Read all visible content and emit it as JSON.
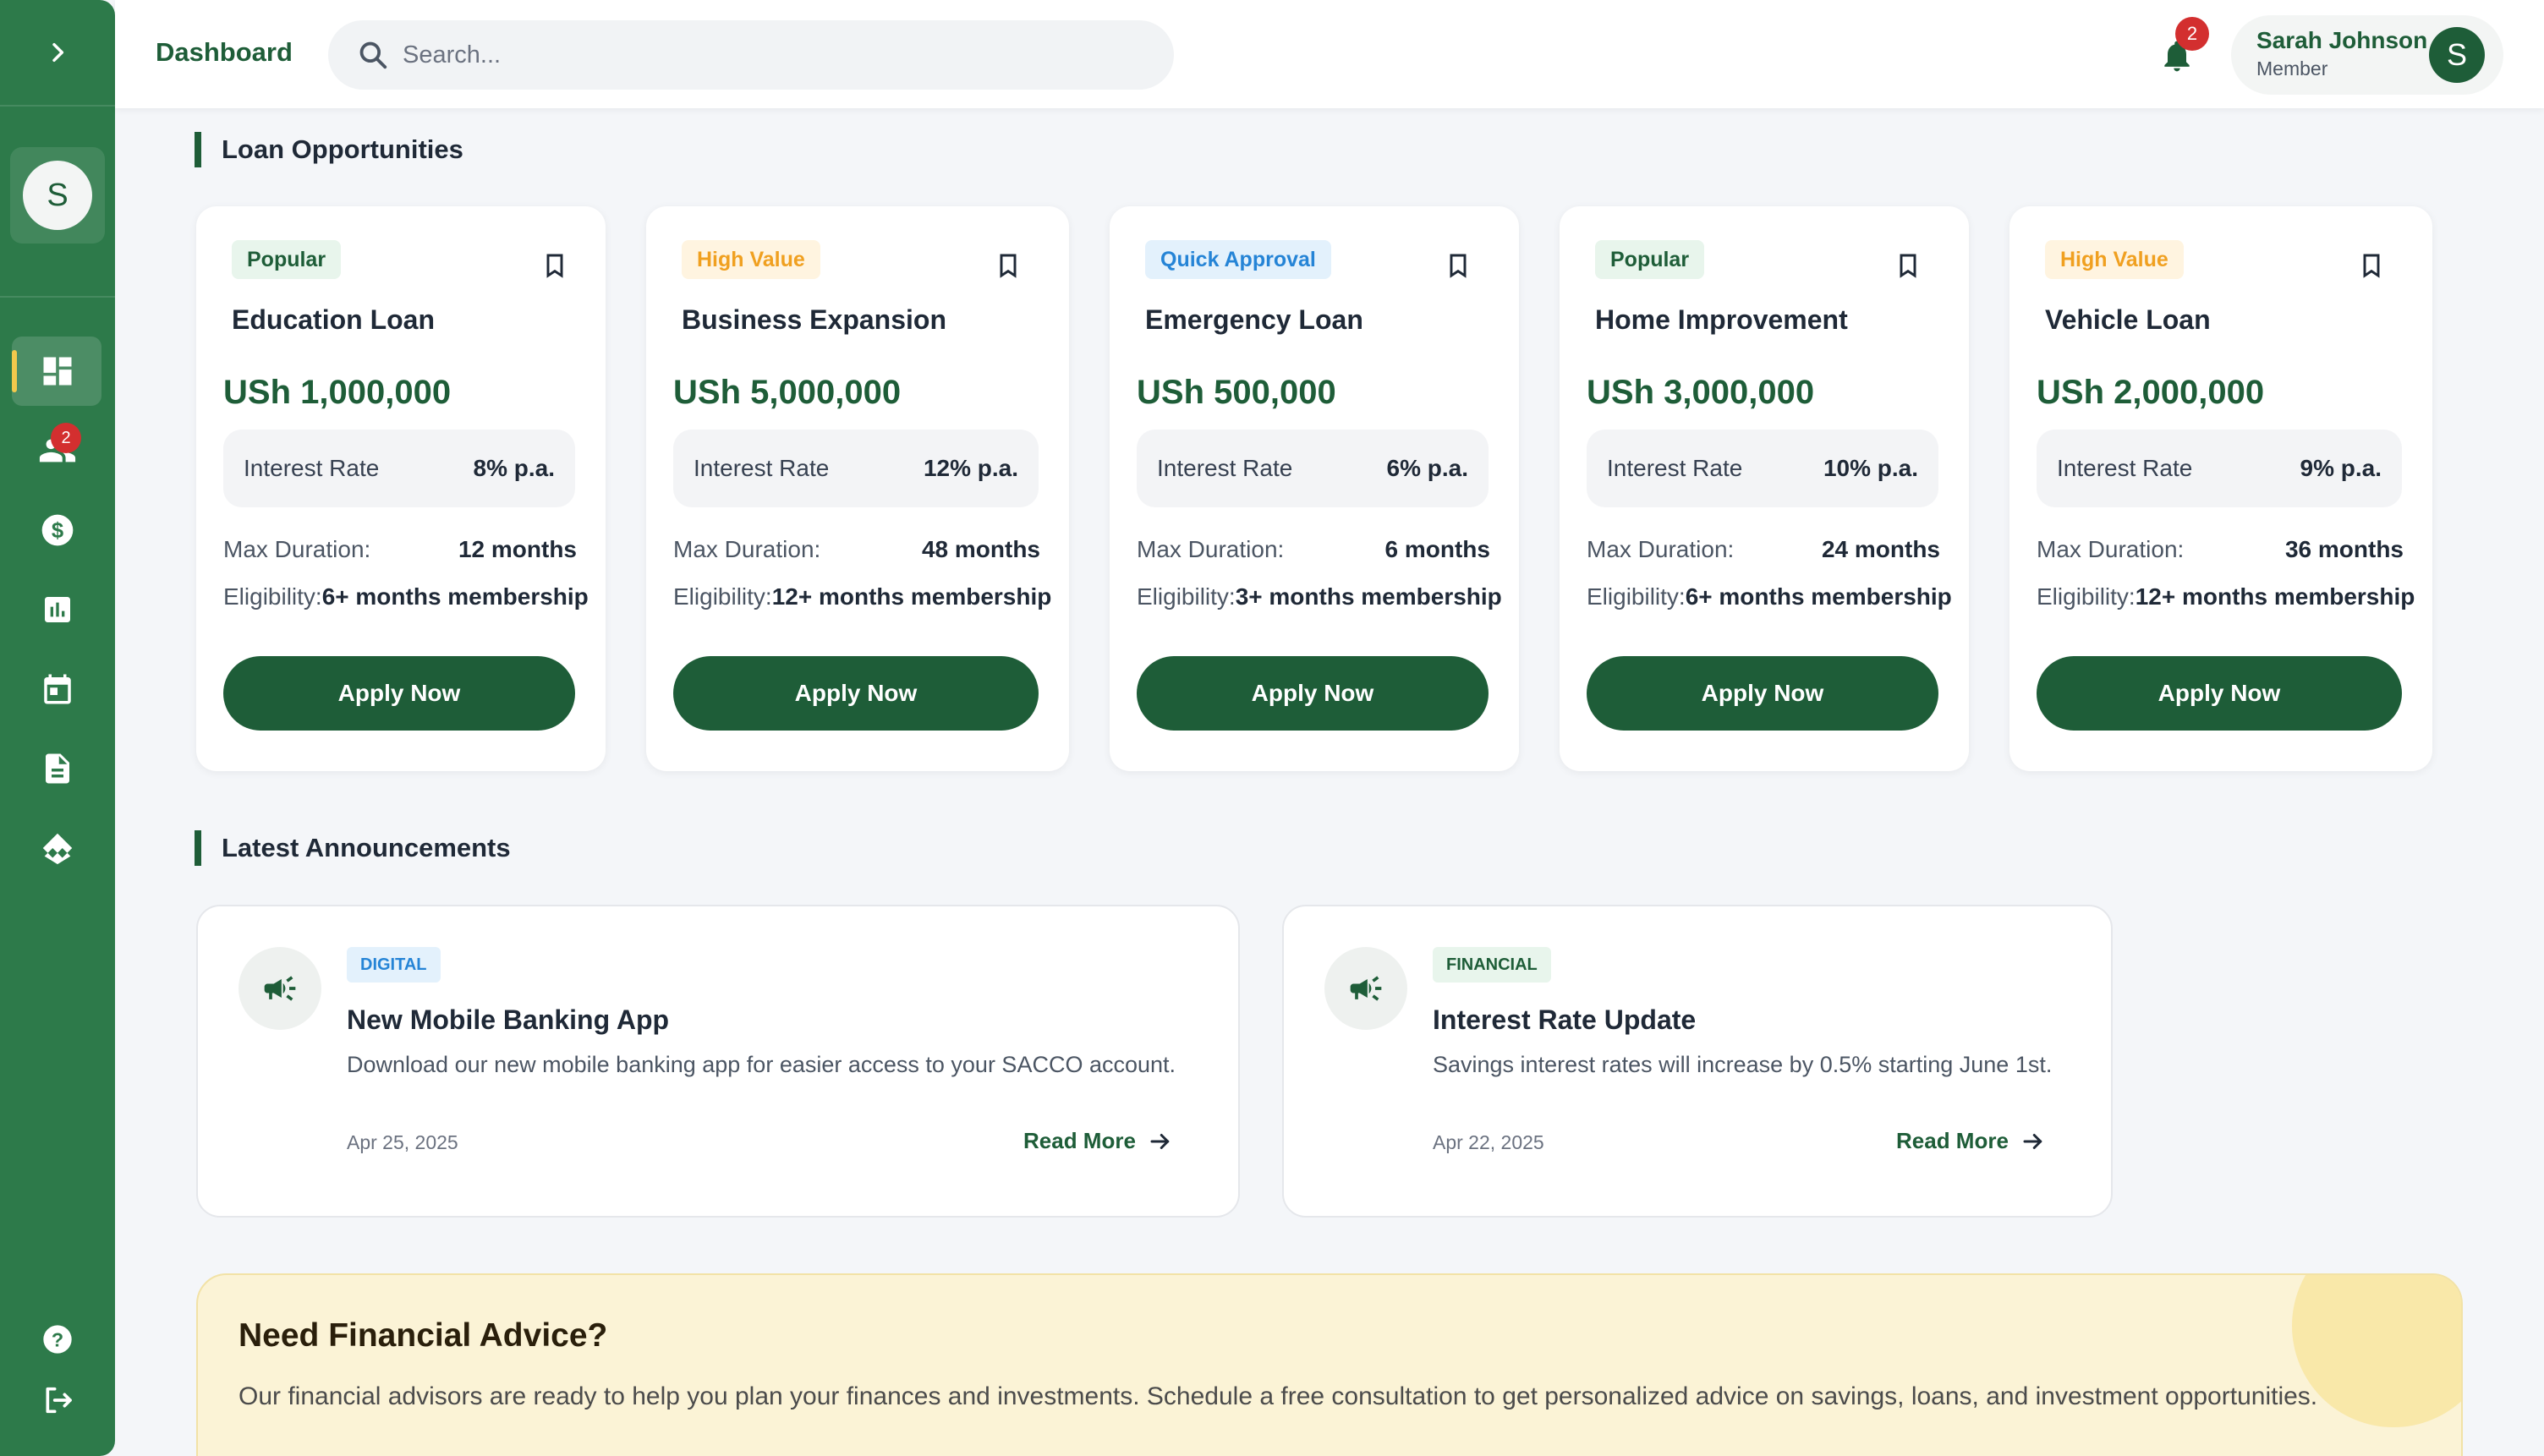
{
  "header": {
    "title": "Dashboard",
    "search_placeholder": "Search...",
    "notification_count": "2",
    "user": {
      "name": "Sarah Johnson",
      "role": "Member",
      "initial": "S"
    }
  },
  "sidebar": {
    "avatar_initial": "S",
    "items": [
      {
        "name": "dashboard-icon",
        "active": true
      },
      {
        "name": "members-icon",
        "badge": "2"
      },
      {
        "name": "dollar-icon"
      },
      {
        "name": "reports-icon"
      },
      {
        "name": "calendar-icon"
      },
      {
        "name": "document-icon"
      },
      {
        "name": "handshake-icon"
      }
    ],
    "bottom": [
      {
        "name": "help-icon"
      },
      {
        "name": "logout-icon"
      }
    ]
  },
  "loans": {
    "heading": "Loan Opportunities",
    "cards": [
      {
        "tag": "Popular",
        "title": "Education Loan",
        "amount": "USh 1,000,000",
        "rate_label": "Interest Rate",
        "rate": "8% p.a.",
        "duration_label": "Max Duration:",
        "duration": "12 months",
        "eligibility_label": "Eligibility:",
        "eligibility": "6+ months membership",
        "button": "Apply Now"
      },
      {
        "tag": "High Value",
        "title": "Business Expansion",
        "amount": "USh 5,000,000",
        "rate_label": "Interest Rate",
        "rate": "12% p.a.",
        "duration_label": "Max Duration:",
        "duration": "48 months",
        "eligibility_label": "Eligibility:",
        "eligibility": "12+ months membership",
        "button": "Apply Now"
      },
      {
        "tag": "Quick Approval",
        "title": "Emergency Loan",
        "amount": "USh 500,000",
        "rate_label": "Interest Rate",
        "rate": "6% p.a.",
        "duration_label": "Max Duration:",
        "duration": "6 months",
        "eligibility_label": "Eligibility:",
        "eligibility": "3+ months membership",
        "button": "Apply Now"
      },
      {
        "tag": "Popular",
        "title": "Home Improvement",
        "amount": "USh 3,000,000",
        "rate_label": "Interest Rate",
        "rate": "10% p.a.",
        "duration_label": "Max Duration:",
        "duration": "24 months",
        "eligibility_label": "Eligibility:",
        "eligibility": "6+ months membership",
        "button": "Apply Now"
      },
      {
        "tag": "High Value",
        "title": "Vehicle Loan",
        "amount": "USh 2,000,000",
        "rate_label": "Interest Rate",
        "rate": "9% p.a.",
        "duration_label": "Max Duration:",
        "duration": "36 months",
        "eligibility_label": "Eligibility:",
        "eligibility": "12+ months membership",
        "button": "Apply Now"
      }
    ]
  },
  "announcements": {
    "heading": "Latest Announcements",
    "items": [
      {
        "tag": "DIGITAL",
        "title": "New Mobile Banking App",
        "description": "Download our new mobile banking app for easier access to your SACCO account.",
        "date": "Apr 25, 2025",
        "link": "Read More"
      },
      {
        "tag": "FINANCIAL",
        "title": "Interest Rate Update",
        "description": "Savings interest rates will increase by 0.5% starting June 1st.",
        "date": "Apr 22, 2025",
        "link": "Read More"
      }
    ]
  },
  "advice": {
    "title": "Need Financial Advice?",
    "text": "Our financial advisors are ready to help you plan your finances and investments. Schedule a free consultation to get personalized advice on savings, loans, and investment opportunities."
  },
  "colors": {
    "primary": "#1e5d38",
    "sidebar": "#2d7a4a",
    "badge": "#d32f2f",
    "tag_popular": "#1e5d38",
    "tag_high_value": "#f0a020",
    "tag_quick": "#2584d6",
    "advice_bg": "#fbf3d6"
  }
}
